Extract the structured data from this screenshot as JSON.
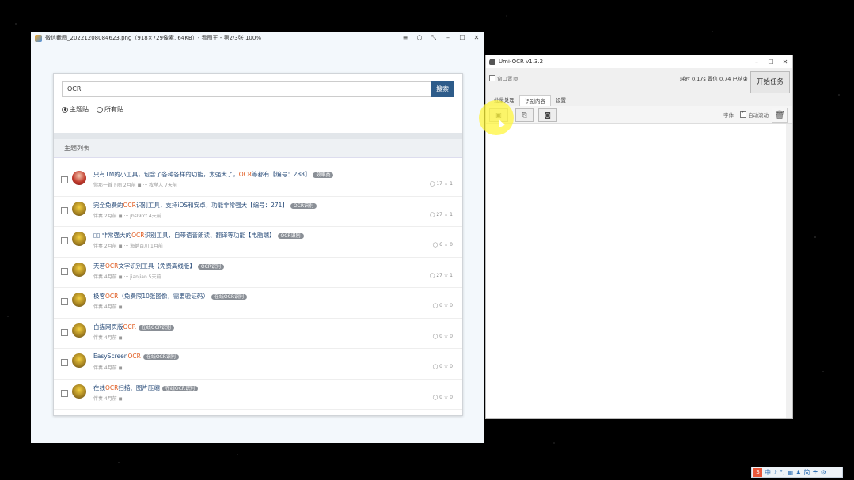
{
  "viewer": {
    "title": "微信截图_20221208084623.png（918×729像素, 64KB）- 看图王 - 第2/3张 100%",
    "controls": [
      "≡",
      "⬡",
      "⤡",
      "–",
      "☐",
      "✕"
    ],
    "search_value": "OCR",
    "search_button": "搜索",
    "radio_main": "主题贴",
    "radio_all": "所有贴",
    "list_header": "主题列表",
    "rows": [
      {
        "pre": "只有1M的小工具，包含了各种各样的功能，太强大了，",
        "hl": "OCR",
        "post": "等都有【编号：288】",
        "tag": "效率类",
        "meta": "你那一首下雨  2月前 ◼ ··· 枚举人  7天前",
        "stats": "◯ 17   ☆ 1",
        "red": true
      },
      {
        "pre": "完全免费的",
        "hl": "OCR",
        "post": "识别工具，支持iOS和安卓，功能非常强大【编号：271】",
        "tag": "OCR识别",
        "meta": "伴奏  2月前 ◼ ··· jbsl9rcf  4天前",
        "stats": "◯ 27   ☆ 1",
        "red": false
      },
      {
        "pre": "▯▯ 非常强大的",
        "hl": "OCR",
        "post": "识别工具，自带语音朗读、翻译等功能【电脑端】",
        "tag": "OCR识别",
        "meta": "伴奏  2月前 ◼ ··· 海纳百川  1月前",
        "stats": "◯ 6   ☆ 0",
        "red": false
      },
      {
        "pre": "天若",
        "hl": "OCR",
        "post": "文字识别工具【免费离线版】",
        "tag": "OCR识别",
        "meta": "伴奏  4月前 ◼ ··· jianjian  5天前",
        "stats": "◯ 27   ☆ 1",
        "red": false
      },
      {
        "pre": "极客",
        "hl": "OCR",
        "post": "（免费限10张图像，需要验证码）",
        "tag": "在线OCR识别",
        "meta": "伴奏  4月前 ◼",
        "stats": "◯ 0   ☆ 0",
        "red": false
      },
      {
        "pre": "白描网页版",
        "hl": "OCR",
        "post": "",
        "tag": "在线OCR识别",
        "meta": "伴奏  4月前 ◼",
        "stats": "◯ 0   ☆ 0",
        "red": false
      },
      {
        "pre": "EasyScreen",
        "hl": "OCR",
        "post": "",
        "tag": "在线OCR识别",
        "meta": "伴奏  4月前 ◼",
        "stats": "◯ 0   ☆ 0",
        "red": false
      },
      {
        "pre": "在线",
        "hl": "OCR",
        "post": "扫描、图片压缩",
        "tag": "在线OCR识别",
        "meta": "伴奏  4月前 ◼",
        "stats": "◯ 0   ☆ 0",
        "red": false
      }
    ]
  },
  "umi": {
    "title": "Umi-OCR v1.3.2",
    "controls": [
      "–",
      "☐",
      "✕"
    ],
    "top_checkbox": "窗口置顶",
    "stats": "耗时 0.17s  置信 0.74  已结束",
    "start_button": "开始任务",
    "tabs": [
      "批量处理",
      "识别内容",
      "设置"
    ],
    "active_tab": 1,
    "tool_icons": [
      "screenshot-icon",
      "clipboard-icon",
      "camera-icon"
    ],
    "font_label": "字体",
    "autoscroll_label": "自动滚动",
    "trash_glyph": "🗑"
  },
  "tray": {
    "items": [
      "中",
      "♪",
      "°,",
      "▦",
      "♟",
      "简",
      "☂",
      "⚙"
    ]
  }
}
